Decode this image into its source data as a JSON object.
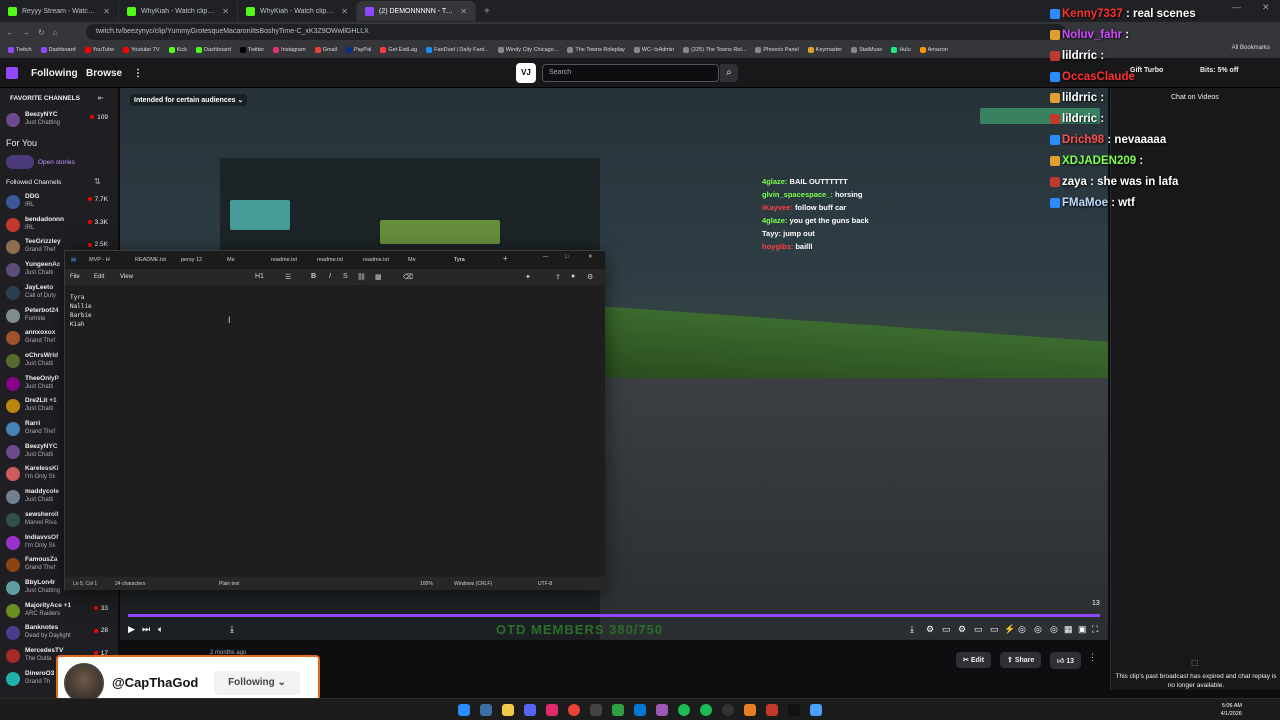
{
  "browser": {
    "tabs": [
      {
        "label": "Reyyy Stream - Watch Live on K",
        "color": "#53fc18"
      },
      {
        "label": "WhyKiah - Watch clips on Kick",
        "color": "#53fc18"
      },
      {
        "label": "WhyKiah - Watch clips on Kick",
        "color": "#53fc18"
      },
      {
        "label": "(2) DEMONNNNN - Twitch",
        "color": "#9147ff"
      }
    ],
    "url": "twitch.tv/beezynyc/clip/YummyGrotesqueMacaroniItsBoshyTime-C_xK3Z9OWwllGHLLX",
    "bookmarks": [
      "Twitch",
      "Dashboard",
      "YouTube",
      "Youtube TV",
      "Kick",
      "Dashboard",
      "Twitter",
      "Instagram",
      "Gmail",
      "PayPal",
      "Get ExitLag",
      "FanDuel | Daily Fant...",
      "Windy City Chicago...",
      "The Towns Roleplay",
      "WC- txAdmin",
      "(225) The Towns Rol...",
      "Phoenix Panel",
      "Keymaster",
      "StatMuse",
      "Hulu",
      "Amazon"
    ],
    "all_bookmarks": "All Bookmarks"
  },
  "twitch_nav": {
    "following": "Following",
    "browse": "Browse",
    "search_placeholder": "Search",
    "gift_turbo": "Gift Turbo",
    "bits": "Bits: 5% off"
  },
  "sidebar": {
    "favorite_header": "FAVORITE CHANNELS",
    "favorites": [
      {
        "name": "BeezyNYC",
        "game": "Just Chatting",
        "viewers": "109"
      }
    ],
    "for_you": "For You",
    "open_stories": "Open stories",
    "followed_header": "Followed Channels",
    "followed": [
      {
        "name": "DDG",
        "game": "IRL",
        "viewers": "7.7K"
      },
      {
        "name": "bendadonnn",
        "game": "IRL",
        "viewers": "3.3K"
      },
      {
        "name": "TeeGrizzley",
        "game": "Grand Thef",
        "viewers": "2.5K"
      },
      {
        "name": "YungeenAc",
        "game": "Just Chatti",
        "viewers": ""
      },
      {
        "name": "JayLeeto",
        "game": "Call of Duty",
        "viewers": ""
      },
      {
        "name": "Peterbot24",
        "game": "Fortnite",
        "viewers": ""
      },
      {
        "name": "annxoxox",
        "game": "Grand Thef",
        "viewers": ""
      },
      {
        "name": "oChrsWrld",
        "game": "Just Chatti",
        "viewers": ""
      },
      {
        "name": "TheeOnlyP",
        "game": "Just Chatti",
        "viewers": ""
      },
      {
        "name": "Dre2Lit +1",
        "game": "Just Chatti",
        "viewers": ""
      },
      {
        "name": "Rarri",
        "game": "Grand Thef",
        "viewers": ""
      },
      {
        "name": "BeezyNYC",
        "game": "Just Chatti",
        "viewers": ""
      },
      {
        "name": "KarelessKl",
        "game": "I'm Only Sk",
        "viewers": ""
      },
      {
        "name": "maddycole",
        "game": "Just Chatti",
        "viewers": ""
      },
      {
        "name": "sewsheroll",
        "game": "Marvel Riva",
        "viewers": ""
      },
      {
        "name": "IndiavvsOf",
        "game": "I'm Only Sk",
        "viewers": ""
      },
      {
        "name": "FamousZa",
        "game": "Grand Thef",
        "viewers": ""
      },
      {
        "name": "BbyLon4r",
        "game": "Just Chatting",
        "viewers": ""
      },
      {
        "name": "MajorityAce +1",
        "game": "ARC Raiders",
        "viewers": "33"
      },
      {
        "name": "Banknotes",
        "game": "Dead by Daylight",
        "viewers": "28"
      },
      {
        "name": "MercedesTV",
        "game": "The Outla",
        "viewers": "17"
      },
      {
        "name": "DineroO3",
        "game": "Grand Th",
        "viewers": ""
      }
    ]
  },
  "video": {
    "audience_label": "Intended for certain audiences",
    "overlay_chat": [
      {
        "user": "4glaze:",
        "msg": "BAIL OUTTTTTT"
      },
      {
        "user": "glvin_spacespace_:",
        "msg": "horsing"
      },
      {
        "user": "iKayvee:",
        "msg": "follow buff car"
      },
      {
        "user": "4glaze:",
        "msg": "you get the guns back"
      },
      {
        "user": "Tayy:",
        "msg": "jump out"
      },
      {
        "user": "hoygibs:",
        "msg": "bailll"
      }
    ],
    "bottom_banner": "OTD MEMBERS 380/750",
    "clip_count": "13"
  },
  "editor": {
    "tabs": [
      "MVP - H",
      "README.txt",
      "persy 12",
      "Me",
      "readme.txt",
      "readme.txt",
      "readme.txt",
      "Me",
      "Tyra"
    ],
    "menu": [
      "File",
      "Edit",
      "View"
    ],
    "heading_tool": "H1",
    "lines": [
      "Tyra",
      "Nallie",
      "Barbie",
      "Kiah"
    ],
    "status": {
      "position": "Ln 5, Col 1",
      "chars": "24 characters",
      "format": "Plain text",
      "zoom": "100%",
      "eol": "Windows (CRLF)",
      "encoding": "UTF-8"
    }
  },
  "below_video": {
    "edit": "Edit",
    "share": "Share",
    "likes": "13",
    "ago": "2 months ago"
  },
  "follow_popup": {
    "name": "@CapThaGod",
    "button": "Following"
  },
  "chat_panel": {
    "title": "Chat on Videos",
    "expired_note": "This clip's past broadcast has expired and chat replay is no longer available."
  },
  "big_chat": [
    {
      "user": "Kenny7337",
      "msg": ": real scenes",
      "color": "#ff3030"
    },
    {
      "user": "Noluv_fahr",
      "msg": ":",
      "color": "#d04aff"
    },
    {
      "user": "lildrric",
      "msg": ":",
      "color": "#ffffff"
    },
    {
      "user": "OccasClaude",
      "msg": "",
      "color": "#ff3030"
    },
    {
      "user": "lildrric",
      "msg": ":",
      "color": "#ffffff"
    },
    {
      "user": "lildrric",
      "msg": ":",
      "color": "#ffffff"
    },
    {
      "user": "Drich98",
      "msg": ": nevaaaaa",
      "color": "#ff5050"
    },
    {
      "user": "XDJADEN209",
      "msg": ":",
      "color": "#7cff4d"
    },
    {
      "user": "zaya",
      "msg": ": she was in lafa",
      "color": "#ffffff"
    },
    {
      "user": "FMaMoe",
      "msg": ": wtf",
      "color": "#c0d8ff"
    }
  ],
  "clock": {
    "time": "5:06 AM",
    "date": "4/1/2026"
  }
}
